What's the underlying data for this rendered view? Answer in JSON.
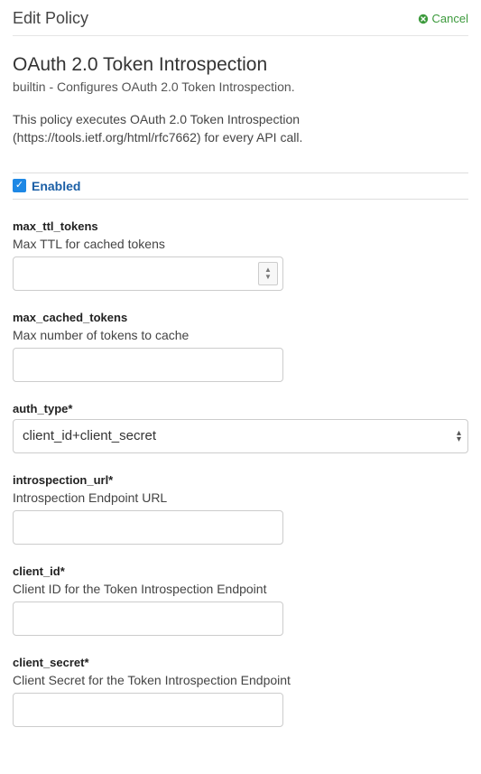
{
  "header": {
    "title": "Edit Policy",
    "cancel_label": "Cancel"
  },
  "policy": {
    "title": "OAuth 2.0 Token Introspection",
    "subtitle": "builtin - Configures OAuth 2.0 Token Introspection.",
    "description": "This policy executes OAuth 2.0 Token Introspection (https://tools.ietf.org/html/rfc7662) for every API call."
  },
  "enabled": {
    "checked": true,
    "label": "Enabled"
  },
  "fields": {
    "max_ttl_tokens": {
      "name": "max_ttl_tokens",
      "help": "Max TTL for cached tokens",
      "value": ""
    },
    "max_cached_tokens": {
      "name": "max_cached_tokens",
      "help": "Max number of tokens to cache",
      "value": ""
    },
    "auth_type": {
      "name": "auth_type*",
      "selected": "client_id+client_secret"
    },
    "introspection_url": {
      "name": "introspection_url*",
      "help": "Introspection Endpoint URL",
      "value": ""
    },
    "client_id": {
      "name": "client_id*",
      "help": "Client ID for the Token Introspection Endpoint",
      "value": ""
    },
    "client_secret": {
      "name": "client_secret*",
      "help": "Client Secret for the Token Introspection Endpoint",
      "value": ""
    }
  }
}
